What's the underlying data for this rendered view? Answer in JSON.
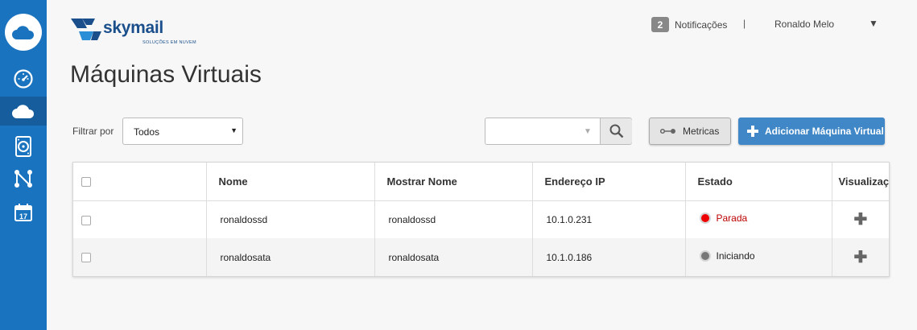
{
  "sidebar": {
    "logo_icon": "cloud-icon",
    "items": [
      {
        "icon": "dashboard-gauge-icon",
        "active": false
      },
      {
        "icon": "cloud-icon",
        "active": true
      },
      {
        "icon": "storage-disk-icon",
        "active": false
      },
      {
        "icon": "network-nodes-icon",
        "active": false
      },
      {
        "icon": "calendar-icon",
        "label": "17",
        "active": false
      }
    ],
    "color": "#1a73be"
  },
  "brand": {
    "name": "skymail",
    "tagline": "SOLUÇÕES EM NUVEM"
  },
  "header": {
    "notifications_count": "2",
    "notifications_label": "Notificações",
    "separator": "|",
    "user_name": "Ronaldo Melo",
    "user_caret": "▼"
  },
  "page": {
    "title": "Máquinas Virtuais"
  },
  "toolbar": {
    "filter_label": "Filtrar por",
    "filter_value": "Todos",
    "search_placeholder": "",
    "metrics_label": "Metricas",
    "add_label": "Adicionar Máquina Virtual"
  },
  "table": {
    "columns": [
      "Nome",
      "Mostrar Nome",
      "Endereço IP",
      "Estado",
      "Visualização"
    ],
    "rows": [
      {
        "nome": "ronaldossd",
        "mostrar_nome": "ronaldossd",
        "ip": "10.1.0.231",
        "estado": "Parada",
        "status_color": "#e00000"
      },
      {
        "nome": "ronaldosata",
        "mostrar_nome": "ronaldosata",
        "ip": "10.1.0.186",
        "estado": "Iniciando",
        "status_color": "#777777"
      }
    ]
  },
  "colors": {
    "accent": "#3f87c7",
    "status_stopped": "#e00000",
    "status_starting": "#777777"
  }
}
